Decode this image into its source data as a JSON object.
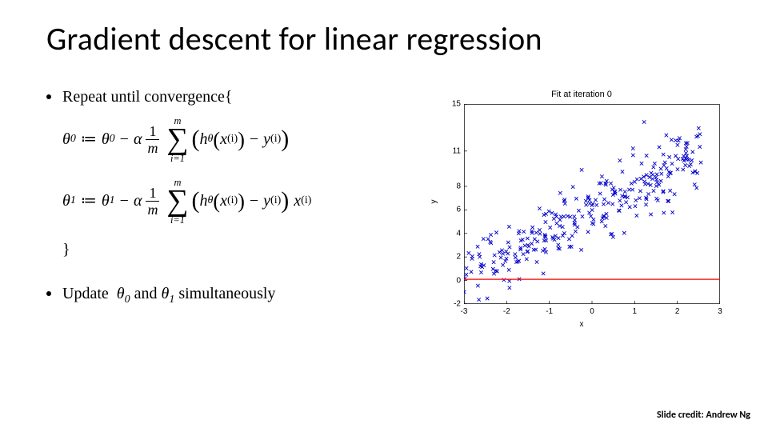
{
  "title": "Gradient descent for linear regression",
  "algo": {
    "repeat": "Repeat until convergence{",
    "close": "}",
    "update_line": "Update  θ₀ and θ₁ simultaneously",
    "theta0_lhs": "θ",
    "theta0_sub": "0",
    "theta1_sub": "1",
    "assign": "≔",
    "alpha": "α",
    "frac_num": "1",
    "frac_den_m": "m",
    "sum_top": "m",
    "sum_bot": "i=1",
    "sum_sym": "∑",
    "lparen": "(",
    "rparen": ")",
    "h": "h",
    "theta_sub": "θ",
    "x": "x",
    "y": "y",
    "sup_i": "(i)",
    "minus": "−"
  },
  "credit": "Slide credit: Andrew Ng",
  "chart_data": {
    "type": "scatter",
    "title": "Fit at iteration 0",
    "xlabel": "x",
    "ylabel": "y",
    "xlim": [
      -3,
      3
    ],
    "ylim": [
      -2,
      15
    ],
    "xticks": [
      -3,
      -2,
      -1,
      0,
      1,
      2,
      3
    ],
    "yticks": [
      -2,
      0,
      2,
      4,
      6,
      8,
      11,
      15
    ],
    "fit_line": {
      "y": 0.1,
      "xmin": -3,
      "xmax": 3,
      "color": "#ff0000"
    },
    "point_color": "#0000cc",
    "n_points": 300,
    "cloud": {
      "x_range": [
        -3,
        2.6
      ],
      "intercept": 6.0,
      "slope": 1.9,
      "noise": 1.4
    }
  }
}
